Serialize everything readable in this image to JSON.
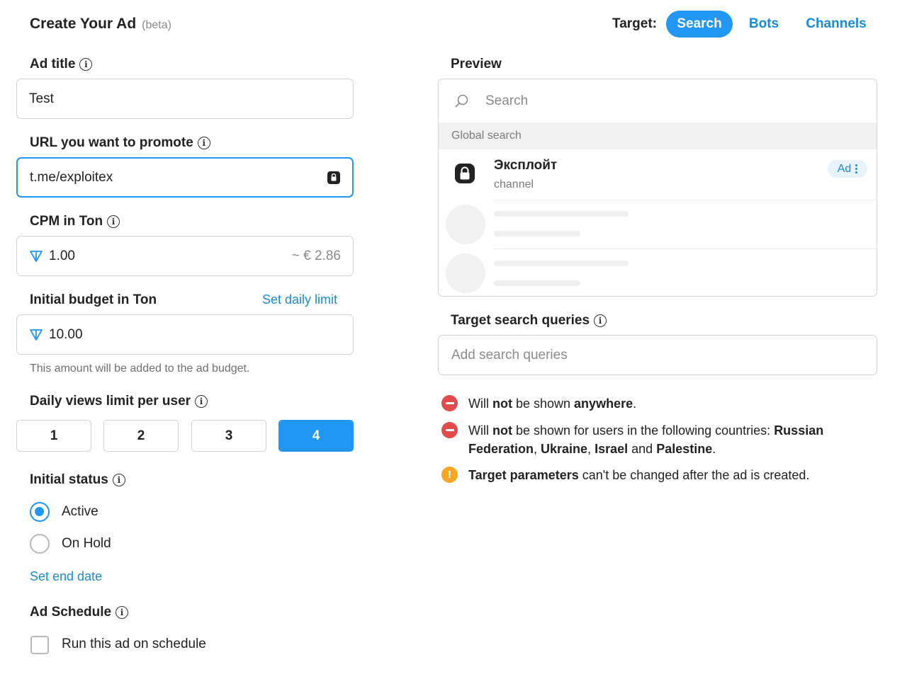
{
  "header": {
    "title": "Create Your Ad",
    "beta": "(beta)",
    "target_label": "Target:",
    "tabs": [
      "Search",
      "Bots",
      "Channels"
    ],
    "active_tab": "Search"
  },
  "form": {
    "ad_title": {
      "label": "Ad title",
      "value": "Test"
    },
    "url": {
      "label": "URL you want to promote",
      "value": "t.me/exploitex"
    },
    "cpm": {
      "label": "CPM in Ton",
      "value": "1.00",
      "approx": "~ € 2.86"
    },
    "budget": {
      "label": "Initial budget in Ton",
      "link": "Set daily limit",
      "value": "10.00",
      "hint": "This amount will be added to the ad budget."
    },
    "daily_limit": {
      "label": "Daily views limit per user",
      "options": [
        "1",
        "2",
        "3",
        "4"
      ],
      "selected": "4"
    },
    "initial_status": {
      "label": "Initial status",
      "options": [
        "Active",
        "On Hold"
      ],
      "selected": "Active"
    },
    "end_date_link": "Set end date",
    "schedule": {
      "label": "Ad Schedule",
      "checkbox_label": "Run this ad on schedule",
      "checked": false
    }
  },
  "preview": {
    "label": "Preview",
    "search_placeholder": "Search",
    "section": "Global search",
    "result": {
      "name": "Эксплойт",
      "type": "channel",
      "badge": "Ad"
    }
  },
  "targeting": {
    "label": "Target search queries",
    "placeholder": "Add search queries",
    "notice1": {
      "pre": "Will ",
      "b1": "not",
      "mid": " be shown ",
      "b2": "anywhere",
      "post": "."
    },
    "notice2": {
      "pre": "Will ",
      "b1": "not",
      "mid": " be shown for users in the following countries: ",
      "c1": "Russian Federation",
      "sep1": ", ",
      "c2": "Ukraine",
      "sep2": ", ",
      "c3": "Israel",
      "sep3": " and ",
      "c4": "Palestine",
      "post": "."
    },
    "notice3": {
      "b1": "Target parameters",
      "post": " can't be changed after the ad is created."
    },
    "colors": {
      "red": "#e24b4b",
      "orange": "#f5a623",
      "accent": "#2196f3"
    }
  }
}
